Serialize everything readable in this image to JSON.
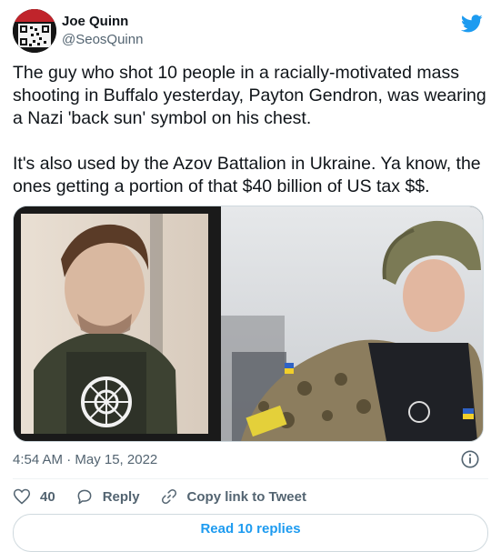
{
  "tweet": {
    "author": {
      "name": "Joe Quinn",
      "handle": "@SeosQuinn"
    },
    "text": "The guy who shot 10 people in a racially-motivated mass shooting in Buffalo yesterday, Payton Gendron, was wearing a Nazi 'back sun' symbol on his chest.\n\nIt's also used by the Azov Battalion in Ukraine. Ya know, the ones getting a portion of that $40 billion of US tax $$.",
    "timestamp": "4:54 AM · May 15, 2022",
    "likes": "40",
    "reply_label": "Reply",
    "copy_link_label": "Copy link to Tweet",
    "read_replies_label": "Read 10 replies"
  },
  "colors": {
    "accent": "#1d9bf0",
    "secondary_text": "#536471",
    "border": "#cfd9de"
  },
  "icons": [
    "twitter-bird-icon",
    "info-icon",
    "heart-icon",
    "reply-icon",
    "link-icon"
  ]
}
